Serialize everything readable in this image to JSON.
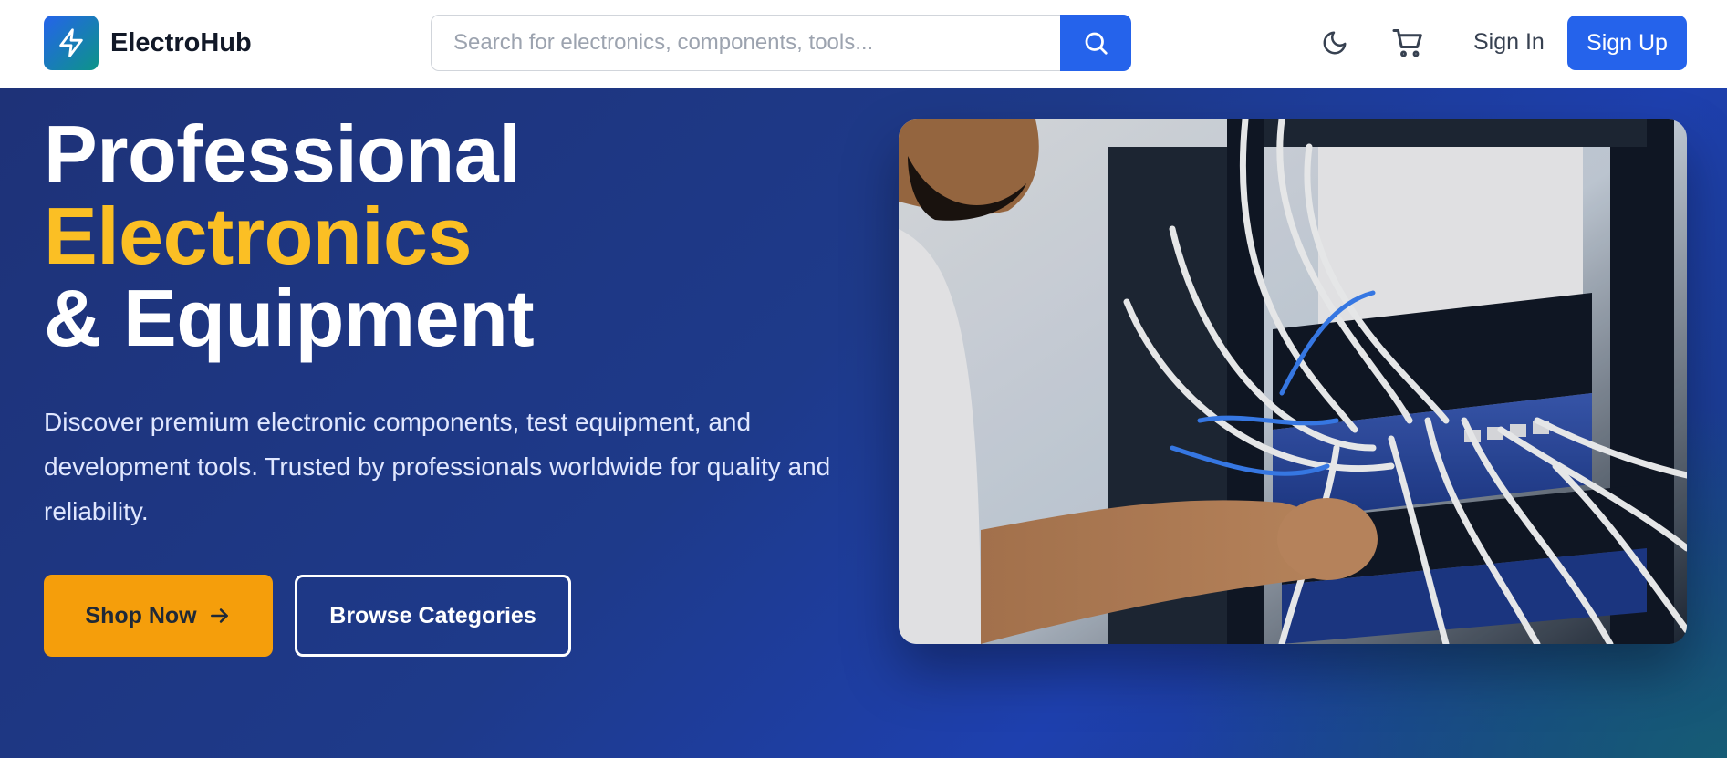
{
  "brand": {
    "name": "ElectroHub",
    "icon": "lightning-bolt-icon"
  },
  "search": {
    "placeholder": "Search for electronics, components, tools...",
    "value": "",
    "icon": "search-icon"
  },
  "nav": {
    "theme_icon": "moon-icon",
    "cart_icon": "cart-icon",
    "signin_label": "Sign In",
    "signup_label": "Sign Up"
  },
  "hero": {
    "title_line1": "Professional",
    "title_line2": "Electronics",
    "title_line3": "& Equipment",
    "description": "Discover premium electronic components, test equipment, and development tools. Trusted by professionals worldwide for quality and reliability.",
    "primary_cta": "Shop Now",
    "secondary_cta": "Browse Categories"
  },
  "colors": {
    "primary": "#2563eb",
    "accent": "#fbbf24",
    "cta": "#f59e0b",
    "hero_bg": "#1e3a8a"
  }
}
